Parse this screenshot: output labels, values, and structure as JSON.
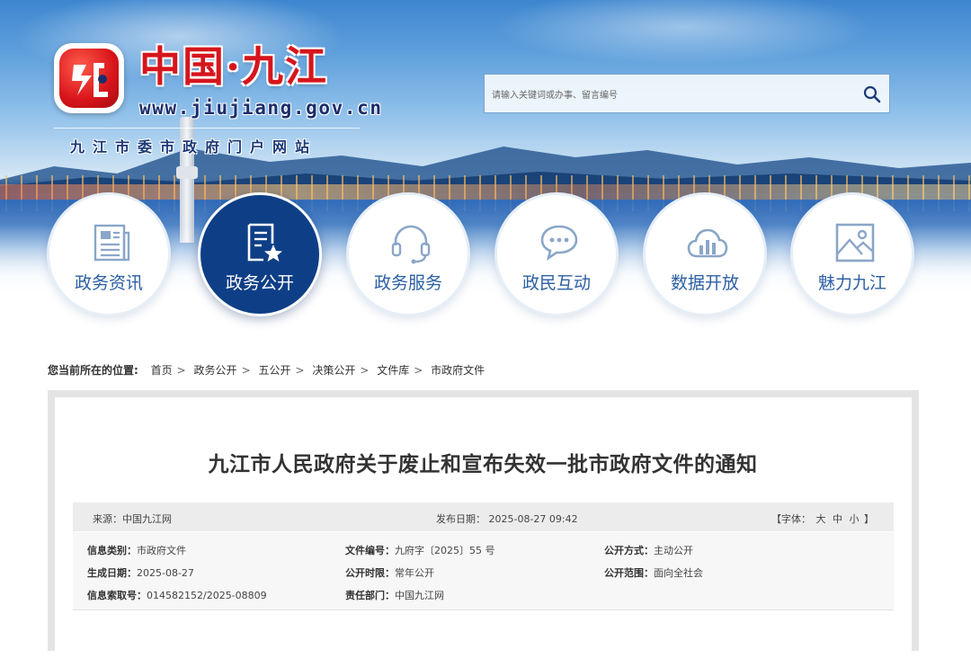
{
  "header": {
    "logo_title": "中国·九江",
    "logo_url": "www.jiujiang.gov.cn",
    "logo_subtitle": "九江市委市政府门户网站"
  },
  "search": {
    "placeholder": "请输入关键词或办事、留言编号",
    "icon": "search-icon"
  },
  "nav": [
    {
      "label": "政务资讯",
      "icon": "news-icon",
      "active": false
    },
    {
      "label": "政务公开",
      "icon": "document-star-icon",
      "active": true
    },
    {
      "label": "政务服务",
      "icon": "headset-icon",
      "active": false
    },
    {
      "label": "政民互动",
      "icon": "chat-bubbles-icon",
      "active": false
    },
    {
      "label": "数据开放",
      "icon": "cloud-chart-icon",
      "active": false
    },
    {
      "label": "魅力九江",
      "icon": "picture-icon",
      "active": false
    }
  ],
  "colors": {
    "primary": "#0e3f86",
    "accent": "#2c5fa3",
    "logo_red": "#d6151c"
  },
  "breadcrumb": {
    "lead": "您当前所在的位置:",
    "items": [
      "首页",
      "政务公开",
      "五公开",
      "决策公开",
      "文件库",
      "市政府文件"
    ]
  },
  "article": {
    "title": "九江市人民政府关于废止和宣布失效一批市政府文件的通知",
    "source": "来源：中国九江网",
    "publish_date": "发布日期：  2025-08-27 09:42",
    "font_label": "【字体：",
    "font_sizes": [
      "大",
      "中",
      "小"
    ],
    "font_close": "】"
  },
  "info": {
    "category_label": "信息类别：",
    "category": "市政府文件",
    "doc_no_label": "文件编号：",
    "doc_no": "九府字〔2025〕55 号",
    "open_mode_label": "公开方式：",
    "open_mode": "主动公开",
    "created_label": "生成日期：",
    "created": "2025-08-27",
    "open_period_label": "公开时限：",
    "open_period": "常年公开",
    "open_scope_label": "公开范围：",
    "open_scope": "面向全社会",
    "index_label": "信息索取号：",
    "index": "014582152/2025-08809",
    "dept_label": "责任部门：",
    "dept": "中国九江网"
  }
}
